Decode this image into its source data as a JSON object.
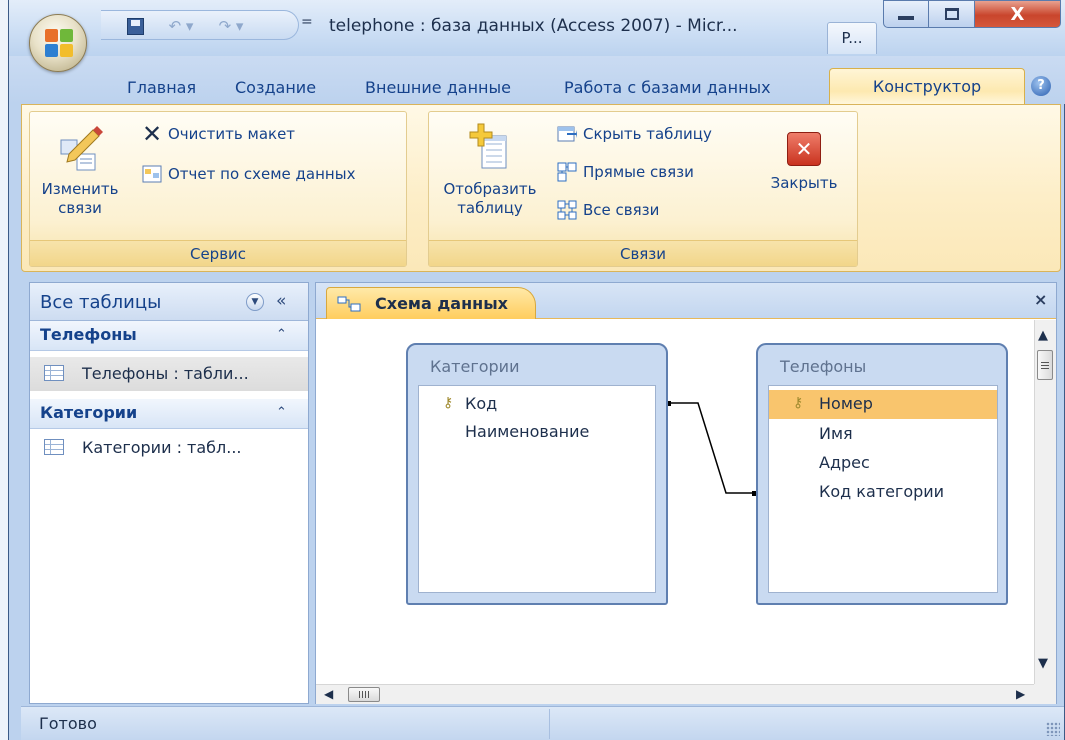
{
  "window": {
    "title": "telephone : база данных (Access 2007) - Micr...",
    "taskbar_button": "P...",
    "qat_customize": "="
  },
  "ribbon": {
    "tabs": [
      {
        "label": "Главная"
      },
      {
        "label": "Создание"
      },
      {
        "label": "Внешние данные"
      },
      {
        "label": "Работа с базами данных"
      },
      {
        "label": "Конструктор",
        "active": true
      }
    ],
    "help": "?",
    "groups": {
      "service": {
        "label": "Сервис",
        "edit_links": {
          "line1": "Изменить",
          "line2": "связи"
        },
        "clear_layout": "Очистить макет",
        "report": "Отчет по схеме данных"
      },
      "links": {
        "label": "Связи",
        "show_table": {
          "line1": "Отобразить",
          "line2": "таблицу"
        },
        "hide_table": "Скрыть таблицу",
        "direct_links": "Прямые связи",
        "all_links": "Все связи",
        "close": "Закрыть"
      }
    }
  },
  "nav": {
    "title": "Все таблицы",
    "groups": [
      {
        "label": "Телефоны",
        "item": "Телефоны : табли..."
      },
      {
        "label": "Категории",
        "item": "Категории : табл..."
      }
    ]
  },
  "document": {
    "tab_label": "Схема данных",
    "close": "×",
    "tables": [
      {
        "title": "Категории",
        "fields": [
          {
            "name": "Код",
            "key": true
          },
          {
            "name": "Наименование",
            "key": false
          }
        ]
      },
      {
        "title": "Телефоны",
        "fields": [
          {
            "name": "Номер",
            "key": true,
            "selected": true
          },
          {
            "name": "Имя",
            "key": false
          },
          {
            "name": "Адрес",
            "key": false
          },
          {
            "name": "Код категории",
            "key": false
          }
        ]
      }
    ],
    "relationship": {
      "from_table": "Категории",
      "from_field": "Код",
      "to_table": "Телефоны",
      "to_field": "Код категории"
    }
  },
  "status": {
    "text": "Готово"
  },
  "colors": {
    "ribbon_bg": "#fdeec8",
    "frame_blue": "#bcd2ee",
    "selected_field": "#f9c56d",
    "text_blue": "#15428b"
  },
  "icons": {
    "office": "office-button-icon",
    "save": "save-icon",
    "undo": "undo-icon",
    "redo": "redo-icon",
    "edit_links": "edit-relationships-icon",
    "clear_layout": "x-icon",
    "report": "report-icon",
    "show_table": "add-table-icon",
    "hide_table": "hide-table-icon",
    "direct_links": "direct-relationships-icon",
    "all_links": "all-relationships-icon",
    "close": "close-red-icon",
    "key": "primary-key-icon"
  }
}
